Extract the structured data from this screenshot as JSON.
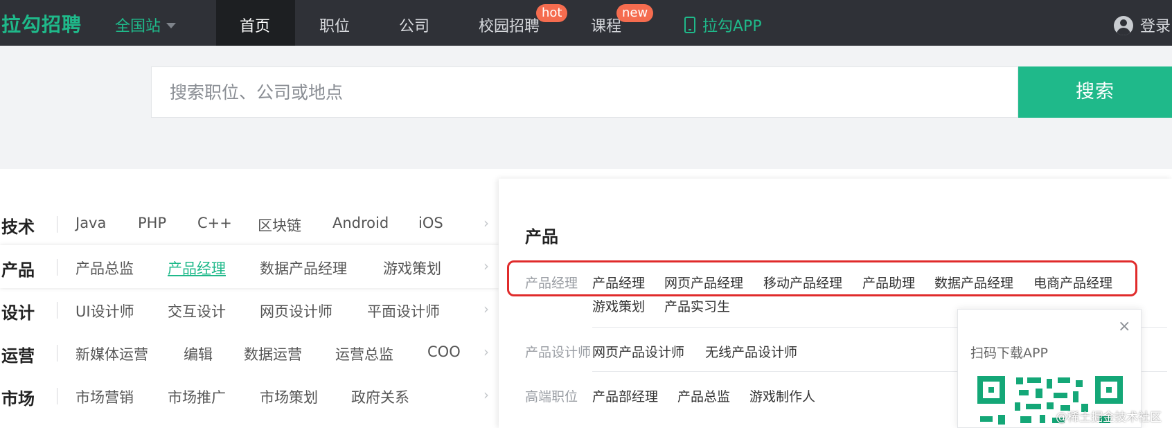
{
  "header": {
    "logo": "拉勾招聘",
    "city": "全国站",
    "nav": [
      {
        "label": "首页"
      },
      {
        "label": "职位"
      },
      {
        "label": "公司"
      },
      {
        "label": "校园招聘",
        "badge": "hot"
      },
      {
        "label": "课程",
        "badge": "new"
      }
    ],
    "app_link": "拉勾APP",
    "login": "登录"
  },
  "search": {
    "placeholder": "搜索职位、公司或地点",
    "button": "搜索"
  },
  "categories": [
    {
      "name": "技术",
      "items": [
        "Java",
        "PHP",
        "C++",
        "区块链",
        "Android",
        "iOS"
      ]
    },
    {
      "name": "产品",
      "items": [
        "产品总监",
        "产品经理",
        "数据产品经理",
        "游戏策划"
      ]
    },
    {
      "name": "设计",
      "items": [
        "UI设计师",
        "交互设计",
        "网页设计师",
        "平面设计师"
      ]
    },
    {
      "name": "运营",
      "items": [
        "新媒体运营",
        "编辑",
        "数据运营",
        "运营总监",
        "COO"
      ]
    },
    {
      "name": "市场",
      "items": [
        "市场营销",
        "市场推广",
        "市场策划",
        "政府关系"
      ]
    }
  ],
  "panel": {
    "title": "产品",
    "groups": [
      {
        "label": "产品经理",
        "items": [
          "产品经理",
          "网页产品经理",
          "移动产品经理",
          "产品助理",
          "数据产品经理",
          "电商产品经理",
          "游戏策划",
          "产品实习生"
        ]
      },
      {
        "label": "产品设计师",
        "items": [
          "网页产品设计师",
          "无线产品设计师"
        ]
      },
      {
        "label": "高端职位",
        "items": [
          "产品部经理",
          "产品总监",
          "游戏制作人"
        ]
      }
    ]
  },
  "app_popup": {
    "text": "扫码下载APP",
    "close": "×"
  },
  "watermark": "@稀土掘金技术社区",
  "colors": {
    "brand": "#1fb98a",
    "topbar": "#2f3137",
    "badge": "#f56c4f",
    "highlight_box": "#e02b2b"
  }
}
